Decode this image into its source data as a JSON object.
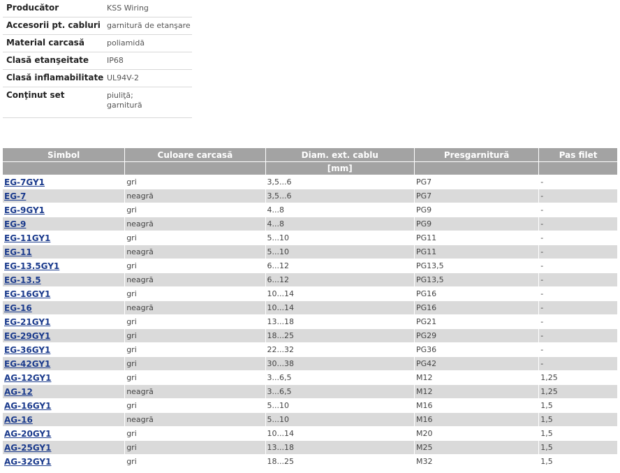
{
  "specs": [
    {
      "key": "Producător",
      "value": [
        "KSS Wiring"
      ]
    },
    {
      "key": "Accesorii pt. cabluri",
      "value": [
        "garnitură de etanşare"
      ]
    },
    {
      "key": "Material carcasă",
      "value": [
        "poliamidă"
      ]
    },
    {
      "key": "Clasă etanşeitate",
      "value": [
        "IP68"
      ]
    },
    {
      "key": "Clasă inflamabilitate",
      "value": [
        "UL94V-2"
      ]
    },
    {
      "key": "Conţinut set",
      "value": [
        "piuliţă;",
        "garnitură"
      ]
    }
  ],
  "table": {
    "headers": [
      "Simbol",
      "Culoare carcasă",
      "Diam. ext. cablu",
      "Presgarnitură",
      "Pas filet"
    ],
    "subheaders": [
      "",
      "",
      "[mm]",
      "",
      ""
    ],
    "rows": [
      [
        "EG-7GY1",
        "gri",
        "3,5...6",
        "PG7",
        "-"
      ],
      [
        "EG-7",
        "neagră",
        "3,5...6",
        "PG7",
        "-"
      ],
      [
        "EG-9GY1",
        "gri",
        "4...8",
        "PG9",
        "-"
      ],
      [
        "EG-9",
        "neagră",
        "4...8",
        "PG9",
        "-"
      ],
      [
        "EG-11GY1",
        "gri",
        "5...10",
        "PG11",
        "-"
      ],
      [
        "EG-11",
        "neagră",
        "5...10",
        "PG11",
        "-"
      ],
      [
        "EG-13.5GY1",
        "gri",
        "6...12",
        "PG13,5",
        "-"
      ],
      [
        "EG-13.5",
        "neagră",
        "6...12",
        "PG13,5",
        "-"
      ],
      [
        "EG-16GY1",
        "gri",
        "10...14",
        "PG16",
        "-"
      ],
      [
        "EG-16",
        "neagră",
        "10...14",
        "PG16",
        "-"
      ],
      [
        "EG-21GY1",
        "gri",
        "13...18",
        "PG21",
        "-"
      ],
      [
        "EG-29GY1",
        "gri",
        "18...25",
        "PG29",
        "-"
      ],
      [
        "EG-36GY1",
        "gri",
        "22...32",
        "PG36",
        "-"
      ],
      [
        "EG-42GY1",
        "gri",
        "30...38",
        "PG42",
        "-"
      ],
      [
        "AG-12GY1",
        "gri",
        "3...6,5",
        "M12",
        "1,25"
      ],
      [
        "AG-12",
        "neagră",
        "3...6,5",
        "M12",
        "1,25"
      ],
      [
        "AG-16GY1",
        "gri",
        "5...10",
        "M16",
        "1,5"
      ],
      [
        "AG-16",
        "neagră",
        "5...10",
        "M16",
        "1,5"
      ],
      [
        "AG-20GY1",
        "gri",
        "10...14",
        "M20",
        "1,5"
      ],
      [
        "AG-25GY1",
        "gri",
        "13...18",
        "M25",
        "1,5"
      ],
      [
        "AG-32GY1",
        "gri",
        "18...25",
        "M32",
        "1,5"
      ]
    ]
  },
  "colors": {
    "header_bg": "#a3a3a3",
    "row_alt_bg": "#dadada",
    "link": "#1a3a8c"
  }
}
